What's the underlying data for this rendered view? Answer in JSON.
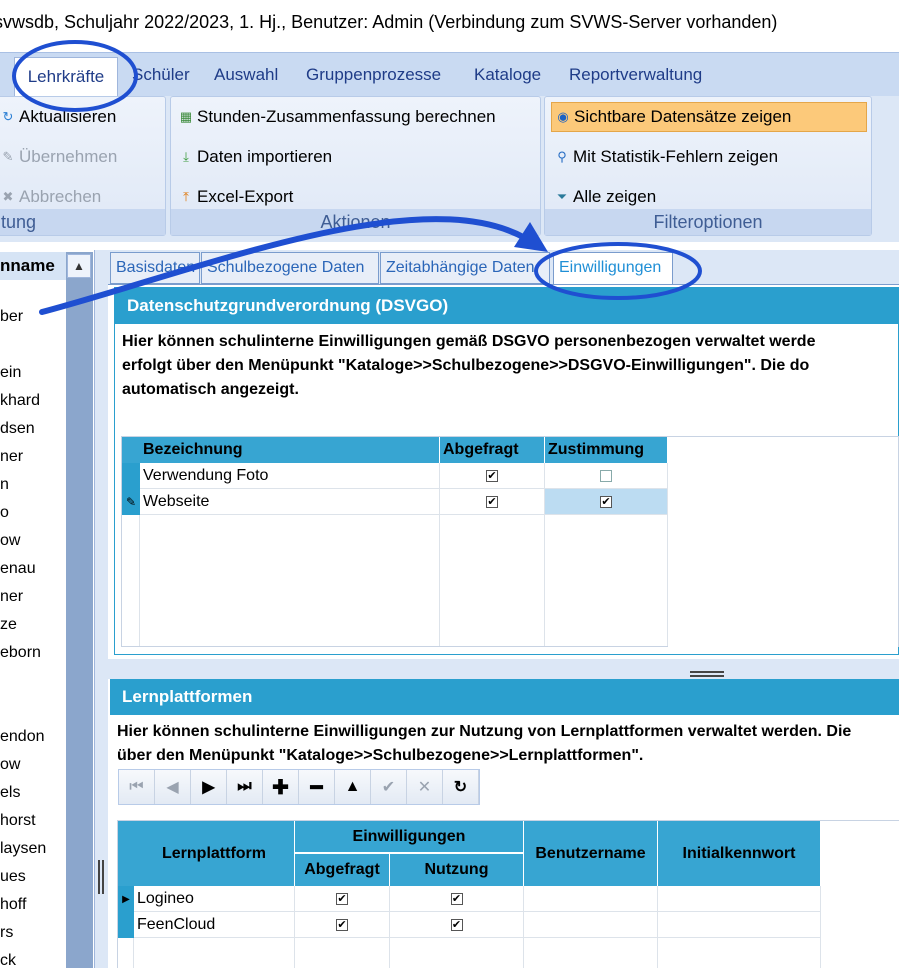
{
  "window": {
    "title": "svwsdb, Schuljahr 2022/2023, 1. Hj., Benutzer: Admin (Verbindung zum SVWS-Server vorhanden)"
  },
  "menu": {
    "tabs": [
      "Lehrkräfte",
      "Schüler",
      "Auswahl",
      "Gruppenprozesse",
      "Kataloge",
      "Reportverwaltung"
    ],
    "active": "Lehrkräfte"
  },
  "ribbon": {
    "group1": {
      "label": "tung",
      "buttons": [
        {
          "label": "Aktualisieren",
          "icon": "refresh-icon",
          "enabled": true
        },
        {
          "label": "Übernehmen",
          "icon": "pencil-icon",
          "enabled": false
        },
        {
          "label": "Abbrechen",
          "icon": "cancel-icon",
          "enabled": false
        }
      ]
    },
    "group2": {
      "label": "Aktionen",
      "buttons": [
        {
          "label": "Stunden-Zusammenfassung berechnen",
          "icon": "calculator-icon"
        },
        {
          "label": "Daten importieren",
          "icon": "import-icon"
        },
        {
          "label": "Excel-Export",
          "icon": "export-icon"
        }
      ]
    },
    "group3": {
      "label": "Filteroptionen",
      "buttons": [
        {
          "label": "Sichtbare Datensätze zeigen",
          "icon": "radio-icon",
          "active": true
        },
        {
          "label": "Mit Statistik-Fehlern zeigen",
          "icon": "magnifier-icon"
        },
        {
          "label": "Alle zeigen",
          "icon": "filter-icon"
        }
      ]
    }
  },
  "left_list": {
    "header": "nname",
    "names": [
      "ber",
      "",
      "ein",
      "khard",
      "dsen",
      "ner",
      "n",
      "o",
      "ow",
      "enau",
      "ner",
      "ze",
      "eborn",
      "",
      "",
      "endon",
      "ow",
      "els",
      "horst",
      "laysen",
      "ues",
      "hoff",
      "rs",
      "ck"
    ]
  },
  "subtabs": [
    "Basisdaten",
    "Schulbezogene Daten",
    "Zeitabhängige Daten",
    "Einwilligungen"
  ],
  "active_subtab": "Einwilligungen",
  "dsgvo": {
    "title": "Datenschutzgrundverordnung (DSVGO)",
    "desc_lines": [
      "Hier können schulinterne Einwilligungen gemäß DSGVO personenbezogen verwaltet werde",
      "erfolgt über den Menüpunkt \"Kataloge>>Schulbezogene>>DSGVO-Einwilligungen\". Die do",
      "automatisch angezeigt."
    ],
    "columns": [
      "Bezeichnung",
      "Abgefragt",
      "Zustimmung"
    ],
    "rows": [
      {
        "bezeichnung": "Verwendung Foto",
        "abgefragt": true,
        "zustimmung": false
      },
      {
        "bezeichnung": "Webseite",
        "abgefragt": true,
        "zustimmung": true
      }
    ]
  },
  "lernplattformen": {
    "title": "Lernplattformen",
    "desc_lines": [
      "Hier können schulinterne Einwilligungen zur Nutzung von Lernplattformen verwaltet werden. Die",
      "über den Menüpunkt \"Kataloge>>Schulbezogene>>Lernplattformen\"."
    ],
    "navigator_icons": [
      "first-icon",
      "prev-icon",
      "next-icon",
      "last-icon",
      "add-icon",
      "remove-icon",
      "up-icon",
      "confirm-icon",
      "cancel-icon",
      "refresh-icon"
    ],
    "columns": {
      "lernplattform": "Lernplattform",
      "einwilligungen": "Einwilligungen",
      "abgefragt": "Abgefragt",
      "nutzung": "Nutzung",
      "benutzername": "Benutzername",
      "initialkennwort": "Initialkennwort"
    },
    "rows": [
      {
        "name": "Logineo",
        "abgefragt": true,
        "nutzung": true
      },
      {
        "name": "FeenCloud",
        "abgefragt": true,
        "nutzung": true
      }
    ]
  },
  "colors": {
    "accent": "#2a9fce",
    "ribbon": "#dce7f6",
    "annotation": "#1f4fd1",
    "filter_active": "#fcc97a"
  }
}
